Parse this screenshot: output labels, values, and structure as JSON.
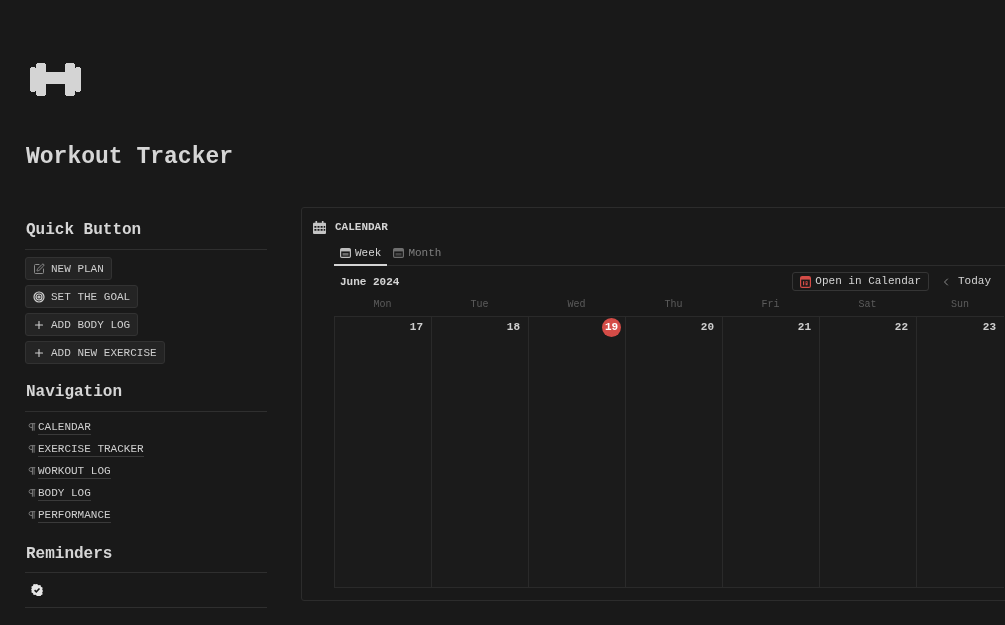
{
  "page": {
    "title": "Workout Tracker"
  },
  "quick_buttons": {
    "heading": "Quick Button",
    "items": [
      {
        "kind": "edit",
        "label": "NEW PLAN"
      },
      {
        "kind": "goal",
        "label": "SET THE GOAL"
      },
      {
        "kind": "add",
        "label": "ADD BODY LOG"
      },
      {
        "kind": "add",
        "label": "ADD NEW EXERCISE"
      }
    ]
  },
  "navigation": {
    "heading": "Navigation",
    "links": [
      {
        "label": "CALENDAR"
      },
      {
        "label": "EXERCISE TRACKER"
      },
      {
        "label": "WORKOUT LOG"
      },
      {
        "label": "BODY LOG"
      },
      {
        "label": "PERFORMANCE"
      }
    ]
  },
  "reminders": {
    "heading": "Reminders"
  },
  "calendar": {
    "title": "CALENDAR",
    "tabs": [
      {
        "label": "Week",
        "selected": true
      },
      {
        "label": "Month",
        "selected": false
      }
    ],
    "month": "June 2024",
    "open_button": "Open in Calendar",
    "today_button": "Today",
    "weekdays": [
      "Mon",
      "Tue",
      "Wed",
      "Thu",
      "Fri",
      "Sat",
      "Sun"
    ],
    "days": [
      {
        "number": "17",
        "today": false
      },
      {
        "number": "18",
        "today": false
      },
      {
        "number": "19",
        "today": true
      },
      {
        "number": "20",
        "today": false
      },
      {
        "number": "21",
        "today": false
      },
      {
        "number": "22",
        "today": false
      },
      {
        "number": "23",
        "today": false
      }
    ]
  }
}
